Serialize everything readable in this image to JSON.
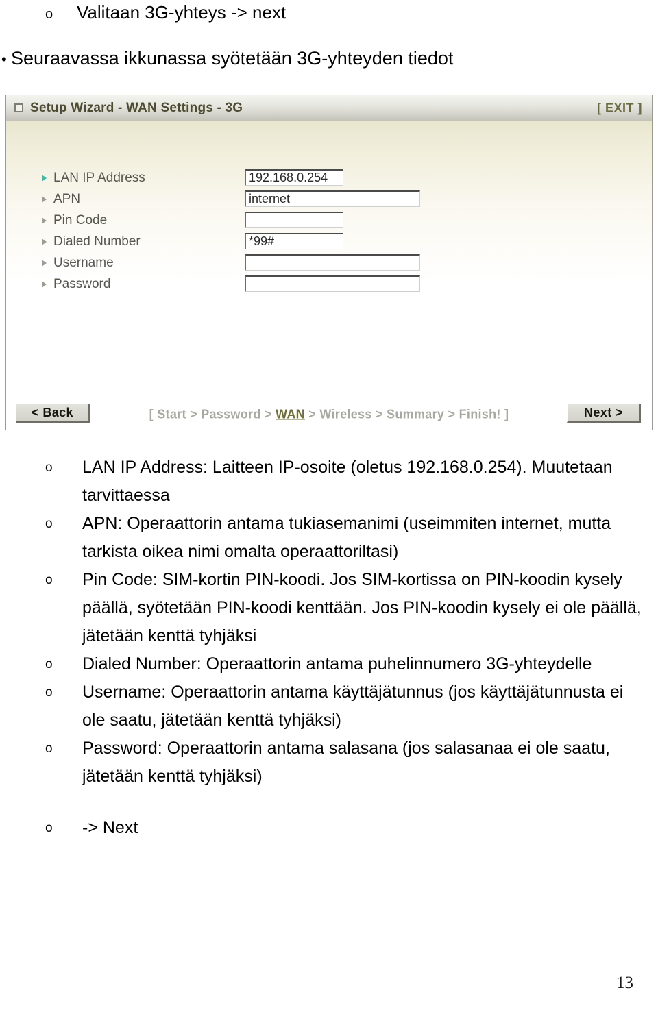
{
  "slide": {
    "bullet_sub_top": {
      "marker": "o",
      "text": "Valitaan 3G-yhteys -> next"
    },
    "bullet_top": {
      "marker": "•",
      "text": "Seuraavassa ikkunassa syötetään 3G-yhteyden tiedot"
    },
    "page_number": "13"
  },
  "router_ui": {
    "titlebar": {
      "icon": "window-square-icon",
      "title": "Setup Wizard - WAN Settings - 3G",
      "exit_label": "[ EXIT ]",
      "exit_color": "#6a6a42"
    },
    "form": {
      "rows": [
        {
          "label": "LAN IP Address",
          "value": "192.168.0.254",
          "placeholder": "",
          "width": "narrow",
          "accent": true
        },
        {
          "label": "APN",
          "value": "internet",
          "placeholder": "",
          "width": "wide",
          "accent": false
        },
        {
          "label": "Pin Code",
          "value": "",
          "placeholder": "",
          "width": "narrow",
          "accent": false
        },
        {
          "label": "Dialed Number",
          "value": "*99#",
          "placeholder": "",
          "width": "narrow",
          "accent": false
        },
        {
          "label": "Username",
          "value": "",
          "placeholder": "",
          "width": "wide",
          "accent": false
        },
        {
          "label": "Password",
          "value": "",
          "placeholder": "",
          "width": "wide",
          "accent": false
        }
      ]
    },
    "footer": {
      "back_label": "< Back",
      "next_label": "Next >",
      "breadcrumb_prefix": "[ Start > Password > ",
      "breadcrumb_active": "WAN",
      "breadcrumb_suffix": " > Wireless > Summary > Finish! ]",
      "active_color": "#6e6e36"
    }
  },
  "explanations": [
    "LAN IP Address: Laitteen IP-osoite (oletus 192.168.0.254). Muutetaan tarvittaessa",
    "APN: Operaattorin antama tukiasemanimi (useimmiten internet, mutta tarkista oikea nimi omalta operaattoriltasi)",
    "Pin Code: SIM-kortin PIN-koodi. Jos SIM-kortissa on PIN-koodin kysely päällä, syötetään PIN-koodi kenttään. Jos PIN-koodin kysely ei ole päällä, jätetään kenttä tyhjäksi",
    "Dialed Number: Operaattorin antama puhelinnumero 3G-yhteydelle",
    "Username: Operaattorin antama käyttäjätunnus (jos käyttäjätunnusta ei ole saatu, jätetään kenttä tyhjäksi)",
    "Password: Operaattorin antama salasana (jos salasanaa ei ole saatu, jätetään kenttä tyhjäksi)"
  ],
  "explanations_marker": "o",
  "final_item": "-> Next"
}
